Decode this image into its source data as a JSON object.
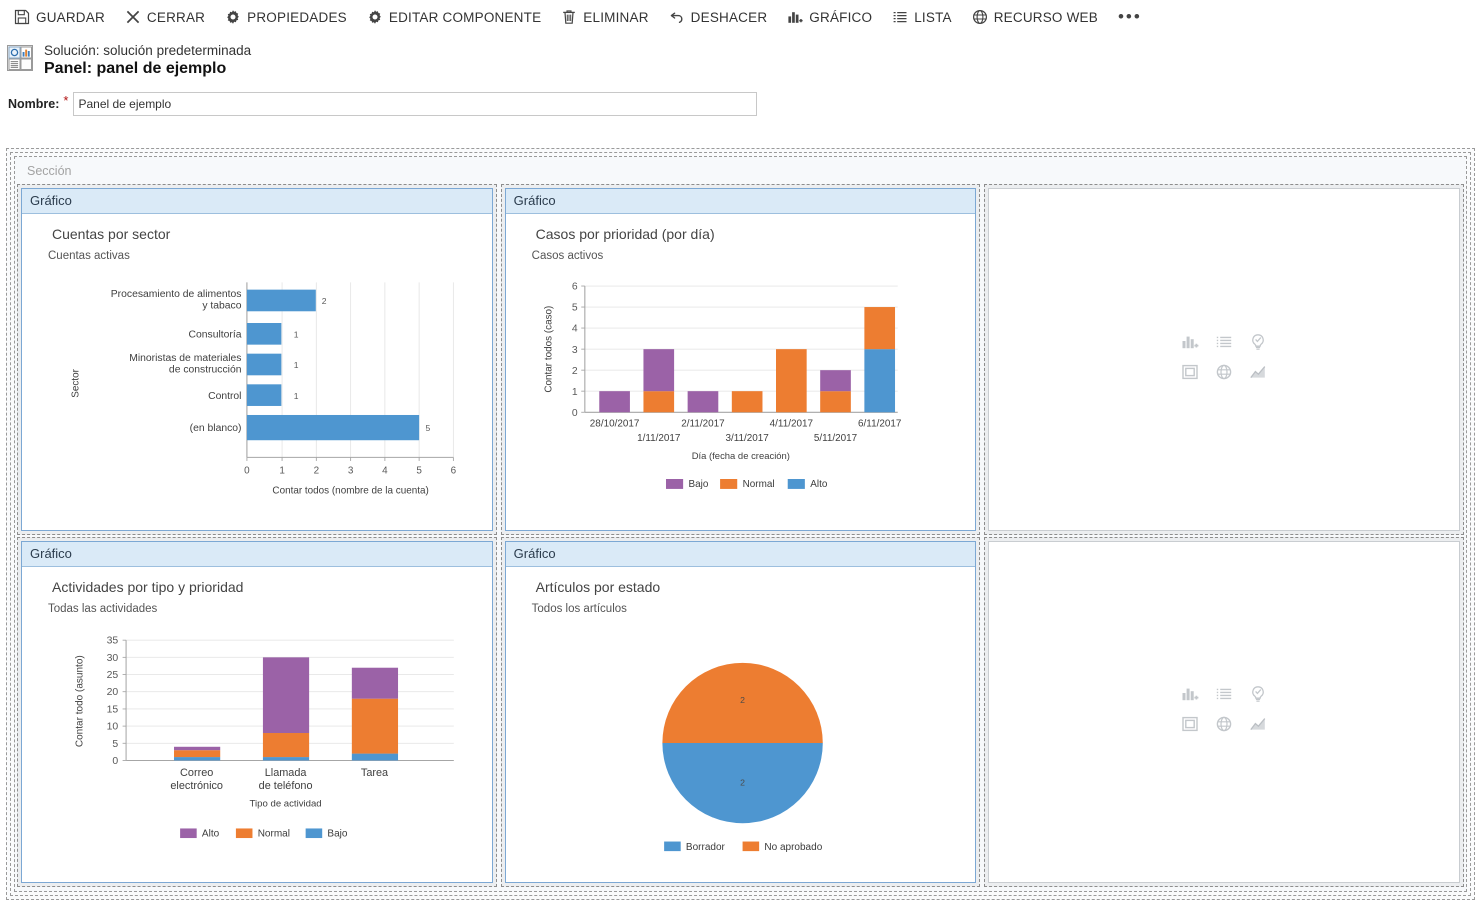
{
  "toolbar": {
    "items": [
      {
        "label": "GUARDAR",
        "icon": "save-icon"
      },
      {
        "label": "CERRAR",
        "icon": "close-x-icon"
      },
      {
        "label": "PROPIEDADES",
        "icon": "gear-icon"
      },
      {
        "label": "EDITAR COMPONENTE",
        "icon": "gear-icon"
      },
      {
        "label": "ELIMINAR",
        "icon": "trash-icon"
      },
      {
        "label": "DESHACER",
        "icon": "undo-arrow-icon"
      },
      {
        "label": "GRÁFICO",
        "icon": "bar-chart-plus-icon"
      },
      {
        "label": "LISTA",
        "icon": "list-icon"
      },
      {
        "label": "RECURSO WEB",
        "icon": "globe-icon"
      }
    ],
    "overflow": "•••"
  },
  "header": {
    "solution_line": "Solución: solución predeterminada",
    "panel_line": "Panel: panel de ejemplo",
    "icon": "dashboard-solution-icon"
  },
  "form": {
    "name_label": "Nombre:",
    "required_marker": "*",
    "name_value": "Panel de ejemplo",
    "name_placeholder": "Panel de ejemplo"
  },
  "canvas": {
    "section_label": "Sección",
    "control_header_label": "Gráfico"
  },
  "placeholder_icons": [
    "bar-chart-plus-icon",
    "list-icon",
    "lightbulb-icon",
    "iframe-icon",
    "globe-icon",
    "trend-chart-icon"
  ],
  "colors": {
    "blue": "#4E96D0",
    "orange": "#ED7D31",
    "purple": "#9B62A7",
    "header_bg": "#DAEAF7",
    "header_text": "#2B3C4D",
    "grid": "#E6E6E6",
    "axis": "#A6A6A6",
    "tick_text": "#595959"
  },
  "chart_data": [
    {
      "id": "cuentas-por-sector",
      "type": "bar",
      "orientation": "horizontal",
      "title": "Cuentas por sector",
      "subtitle": "Cuentas activas",
      "xlabel": "Contar todos (nombre de la cuenta)",
      "ylabel": "Sector",
      "categories": [
        "Procesamiento de alimentos y tabaco",
        "Consultoría",
        "Minoristas de materiales de construcción",
        "Control",
        "(en blanco)"
      ],
      "values": [
        2,
        1,
        1,
        1,
        5
      ],
      "data_labels": [
        "2",
        "1",
        "1",
        "1",
        "5"
      ],
      "xticks": [
        "0",
        "1",
        "2",
        "3",
        "4",
        "5",
        "6"
      ],
      "xlim": [
        0,
        6
      ],
      "grid": true,
      "series_color": "#4E96D0",
      "legend": null
    },
    {
      "id": "casos-por-prioridad",
      "type": "bar",
      "orientation": "vertical",
      "stacked": true,
      "title": "Casos por prioridad (por día)",
      "subtitle": "Casos activos",
      "xlabel": "Día (fecha de creación)",
      "ylabel": "Contar todos (caso)",
      "categories": [
        "28/10/2017",
        "1/11/2017",
        "2/11/2017",
        "3/11/2017",
        "4/11/2017",
        "5/11/2017",
        "6/11/2017"
      ],
      "yticks": [
        "0",
        "1",
        "2",
        "3",
        "4",
        "5",
        "6"
      ],
      "ylim": [
        0,
        6
      ],
      "grid": true,
      "series": [
        {
          "name": "Bajo",
          "color": "#9B62A7",
          "values": [
            1,
            2,
            1,
            0,
            0,
            1,
            0
          ]
        },
        {
          "name": "Normal",
          "color": "#ED7D31",
          "values": [
            0,
            1,
            0,
            1,
            3,
            1,
            2
          ]
        },
        {
          "name": "Alto",
          "color": "#4E96D0",
          "values": [
            0,
            0,
            0,
            0,
            0,
            0,
            3
          ]
        }
      ],
      "legend": {
        "position": "bottom",
        "entries": [
          "Bajo",
          "Normal",
          "Alto"
        ]
      }
    },
    {
      "id": "actividades-por-tipo-y-prioridad",
      "type": "bar",
      "orientation": "vertical",
      "stacked": true,
      "title": "Actividades por tipo y prioridad",
      "subtitle": "Todas las actividades",
      "xlabel": "Tipo de actividad",
      "ylabel": "Contar todo (asunto)",
      "categories": [
        "Correo electrónico",
        "Llamada de teléfono",
        "Tarea"
      ],
      "yticks": [
        "0",
        "5",
        "10",
        "15",
        "20",
        "25",
        "30",
        "35"
      ],
      "ylim": [
        0,
        35
      ],
      "grid": true,
      "series": [
        {
          "name": "Bajo",
          "color": "#4E96D0",
          "values": [
            1,
            1,
            2
          ]
        },
        {
          "name": "Normal",
          "color": "#ED7D31",
          "values": [
            2,
            7,
            16
          ]
        },
        {
          "name": "Alto",
          "color": "#9B62A7",
          "values": [
            1,
            22,
            9
          ]
        }
      ],
      "legend": {
        "position": "bottom",
        "entries": [
          "Alto",
          "Normal",
          "Bajo"
        ]
      }
    },
    {
      "id": "articulos-por-estado",
      "type": "pie",
      "title": "Artículos por estado",
      "subtitle": "Todos los artículos",
      "labels": [
        "No aprobado",
        "Borrador"
      ],
      "values": [
        2,
        2
      ],
      "data_labels": [
        "2",
        "2"
      ],
      "colors": [
        "#ED7D31",
        "#4E96D0"
      ],
      "legend": {
        "position": "bottom",
        "entries": [
          "Borrador",
          "No aprobado"
        ]
      }
    }
  ]
}
